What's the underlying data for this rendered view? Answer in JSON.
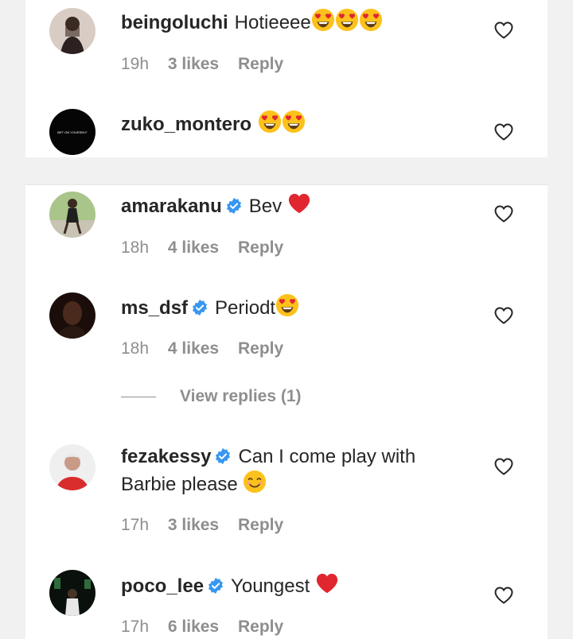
{
  "comments": [
    {
      "username": "beingoluchi",
      "verified": false,
      "text": "Hotieeee",
      "emojis": "heart-eyes x3",
      "time": "19h",
      "likes": "3 likes",
      "reply": "Reply"
    },
    {
      "username": "zuko_montero",
      "verified": false,
      "text": "",
      "emojis": "heart-eyes x2",
      "avatar_text": "BET ON YOURSELF"
    },
    {
      "username": "amarakanu",
      "verified": true,
      "text": "Bev",
      "emojis": "red-heart",
      "time": "18h",
      "likes": "4 likes",
      "reply": "Reply"
    },
    {
      "username": "ms_dsf",
      "verified": true,
      "text": "Periodt",
      "emojis": "heart-eyes",
      "time": "18h",
      "likes": "4 likes",
      "reply": "Reply",
      "view_replies": "View replies (1)"
    },
    {
      "username": "fezakessy",
      "verified": true,
      "text": "Can I come play with Barbie please",
      "emojis": "smiling-face",
      "time": "17h",
      "likes": "3 likes",
      "reply": "Reply"
    },
    {
      "username": "poco_lee",
      "verified": true,
      "text": "Youngest",
      "emojis": "red-heart",
      "time": "17h",
      "likes": "6 likes",
      "reply": "Reply"
    }
  ],
  "colors": {
    "text": "#262626",
    "meta": "#8e8e8e",
    "verified": "#3897f0",
    "heart_emoji": "#e0262f",
    "emoji_face": "#fcc21b"
  }
}
